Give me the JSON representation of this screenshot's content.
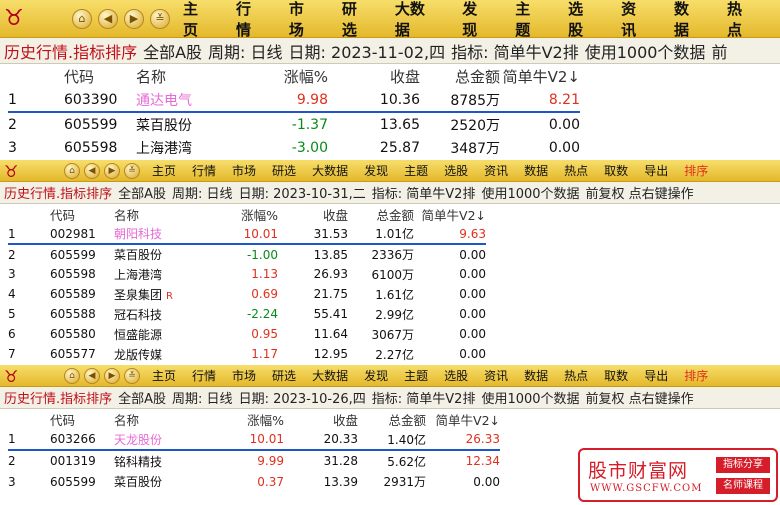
{
  "toolbar": {
    "logo_glyph": "♉",
    "nav_icons": [
      "home-icon",
      "back-icon",
      "forward-icon",
      "down-icon"
    ],
    "top_items": [
      "主页",
      "行情",
      "市场",
      "研选",
      "大数据",
      "发现",
      "主题",
      "选股",
      "资讯",
      "数据",
      "热点"
    ],
    "full_items": [
      "主页",
      "行情",
      "市场",
      "研选",
      "大数据",
      "发现",
      "主题",
      "选股",
      "资讯",
      "数据",
      "热点",
      "取数",
      "导出",
      "排序"
    ],
    "active_item": "排序"
  },
  "panels": [
    {
      "status": {
        "title": "历史行情.指标排序",
        "scope": "全部A股",
        "period": "周期: 日线",
        "date": "日期: 2023-11-02,四",
        "indicator": "指标: 简单牛V2排",
        "use": "使用1000个数据",
        "tail": "前"
      },
      "headers": {
        "code": "代码",
        "name": "名称",
        "chg": "涨幅%",
        "close": "收盘",
        "amount": "总金额",
        "v2": "简单牛V2↓"
      },
      "rows": [
        {
          "idx": "1",
          "code": "603390",
          "name": "通达电气",
          "chg": "9.98",
          "close": "10.36",
          "amount": "8785万",
          "v2": "8.21",
          "chg_dir": "up",
          "v2_dir": "up",
          "selected": true,
          "mark": ""
        },
        {
          "idx": "2",
          "code": "605599",
          "name": "菜百股份",
          "chg": "-1.37",
          "close": "13.65",
          "amount": "2520万",
          "v2": "0.00",
          "chg_dir": "dn",
          "v2_dir": "flat",
          "selected": false,
          "mark": ""
        },
        {
          "idx": "3",
          "code": "605598",
          "name": "上海港湾",
          "chg": "-3.00",
          "close": "25.87",
          "amount": "3487万",
          "v2": "0.00",
          "chg_dir": "dn",
          "v2_dir": "flat",
          "selected": false,
          "mark": ""
        }
      ]
    },
    {
      "status": {
        "title": "历史行情.指标排序",
        "scope": "全部A股",
        "period": "周期: 日线",
        "date": "日期: 2023-10-31,二",
        "indicator": "指标: 简单牛V2排",
        "use": "使用1000个数据",
        "tail": "前复权 点右键操作"
      },
      "headers": {
        "code": "代码",
        "name": "名称",
        "chg": "涨幅%",
        "close": "收盘",
        "amount": "总金额",
        "v2": "简单牛V2↓"
      },
      "rows": [
        {
          "idx": "1",
          "code": "002981",
          "name": "朝阳科技",
          "chg": "10.01",
          "close": "31.53",
          "amount": "1.01亿",
          "v2": "9.63",
          "chg_dir": "up",
          "v2_dir": "up",
          "selected": true,
          "mark": ""
        },
        {
          "idx": "2",
          "code": "605599",
          "name": "菜百股份",
          "chg": "-1.00",
          "close": "13.85",
          "amount": "2336万",
          "v2": "0.00",
          "chg_dir": "dn",
          "v2_dir": "flat",
          "selected": false,
          "mark": ""
        },
        {
          "idx": "3",
          "code": "605598",
          "name": "上海港湾",
          "chg": "1.13",
          "close": "26.93",
          "amount": "6100万",
          "v2": "0.00",
          "chg_dir": "up",
          "v2_dir": "flat",
          "selected": false,
          "mark": ""
        },
        {
          "idx": "4",
          "code": "605589",
          "name": "圣泉集团",
          "chg": "0.69",
          "close": "21.75",
          "amount": "1.61亿",
          "v2": "0.00",
          "chg_dir": "up",
          "v2_dir": "flat",
          "selected": false,
          "mark": "R"
        },
        {
          "idx": "5",
          "code": "605588",
          "name": "冠石科技",
          "chg": "-2.24",
          "close": "55.41",
          "amount": "2.99亿",
          "v2": "0.00",
          "chg_dir": "dn",
          "v2_dir": "flat",
          "selected": false,
          "mark": ""
        },
        {
          "idx": "6",
          "code": "605580",
          "name": "恒盛能源",
          "chg": "0.95",
          "close": "11.64",
          "amount": "3067万",
          "v2": "0.00",
          "chg_dir": "up",
          "v2_dir": "flat",
          "selected": false,
          "mark": ""
        },
        {
          "idx": "7",
          "code": "605577",
          "name": "龙版传媒",
          "chg": "1.17",
          "close": "12.95",
          "amount": "2.27亿",
          "v2": "0.00",
          "chg_dir": "up",
          "v2_dir": "flat",
          "selected": false,
          "mark": ""
        }
      ]
    },
    {
      "status": {
        "title": "历史行情.指标排序",
        "scope": "全部A股",
        "period": "周期: 日线",
        "date": "日期: 2023-10-26,四",
        "indicator": "指标: 简单牛V2排",
        "use": "使用1000个数据",
        "tail": "前复权 点右键操作"
      },
      "headers": {
        "code": "代码",
        "name": "名称",
        "chg": "涨幅%",
        "close": "收盘",
        "amount": "总金额",
        "v2": "简单牛V2↓"
      },
      "rows": [
        {
          "idx": "1",
          "code": "603266",
          "name": "天龙股份",
          "chg": "10.01",
          "close": "20.33",
          "amount": "1.40亿",
          "v2": "26.33",
          "chg_dir": "up",
          "v2_dir": "up",
          "selected": true,
          "mark": ""
        },
        {
          "idx": "2",
          "code": "001319",
          "name": "铭科精技",
          "chg": "9.99",
          "close": "31.28",
          "amount": "5.62亿",
          "v2": "12.34",
          "chg_dir": "up",
          "v2_dir": "up",
          "selected": false,
          "mark": ""
        },
        {
          "idx": "3",
          "code": "605599",
          "name": "菜百股份",
          "chg": "0.37",
          "close": "13.39",
          "amount": "2931万",
          "v2": "0.00",
          "chg_dir": "up",
          "v2_dir": "flat",
          "selected": false,
          "mark": ""
        }
      ]
    }
  ],
  "watermark": {
    "title": "股市财富网",
    "url": "WWW.GSCFW.COM",
    "tag1": "指标分享",
    "tag2": "名师课程"
  },
  "colors": {
    "up": "#e0301e",
    "down": "#0a8a1a",
    "selected_name": "#e86ad6",
    "toolbar": "#e4b82c",
    "brand_red": "#d51e2a"
  }
}
